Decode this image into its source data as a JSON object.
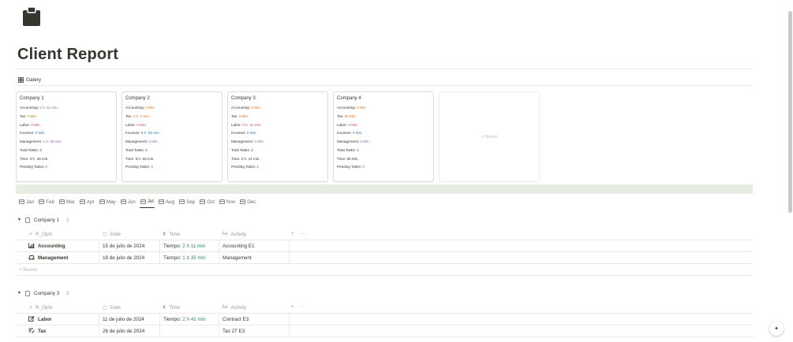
{
  "page": {
    "title": "Client Report",
    "icon": "clipboard-icon"
  },
  "view": {
    "tab_label": "Galery",
    "icon": "grid-icon"
  },
  "cards": [
    {
      "title": "Company 1",
      "rows": [
        {
          "label": "Accounting: ",
          "value": "2 h. 11 min.",
          "color": "purple"
        },
        {
          "label": "Tax: ",
          "value": "0 Min.",
          "color": "orange"
        },
        {
          "label": "Labor: ",
          "value": "0 Min.",
          "color": "red"
        },
        {
          "label": "Incomes: ",
          "value": "0 Min.",
          "color": "blue"
        },
        {
          "label": "Management: ",
          "value": "1 h. 35 min.",
          "color": "purple"
        },
        {
          "label": "Total Tasks: ",
          "value": "2",
          "color": "black"
        },
        {
          "label": "Time: ",
          "value": "3 h. 46 min.",
          "color": "black"
        },
        {
          "label": "Pending Tasks: ",
          "value": "0",
          "color": "red"
        }
      ]
    },
    {
      "title": "Company 2",
      "rows": [
        {
          "label": "Accounting: ",
          "value": "0 Min.",
          "color": "orange"
        },
        {
          "label": "Tax: ",
          "value": "2 h. 4 min.",
          "color": "orange"
        },
        {
          "label": "Labor: ",
          "value": "0 Min.",
          "color": "red"
        },
        {
          "label": "Incomes: ",
          "value": "6 h. 55 min.",
          "color": "blue"
        },
        {
          "label": "Management: ",
          "value": "0 Min.",
          "color": "purple"
        },
        {
          "label": "Total Tasks: ",
          "value": "2",
          "color": "black"
        },
        {
          "label": "Time: ",
          "value": "8 h. 59 min.",
          "color": "black"
        },
        {
          "label": "Pending Tasks: ",
          "value": "0",
          "color": "red"
        }
      ]
    },
    {
      "title": "Company 3",
      "rows": [
        {
          "label": "Accounting: ",
          "value": "0 Min.",
          "color": "orange"
        },
        {
          "label": "Tax: ",
          "value": "0 Min.",
          "color": "orange"
        },
        {
          "label": "Labor: ",
          "value": "2 h. 41 min.",
          "color": "red"
        },
        {
          "label": "Incomes: ",
          "value": "0 Min.",
          "color": "blue"
        },
        {
          "label": "Management: ",
          "value": "0 Min.",
          "color": "purple"
        },
        {
          "label": "Total Tasks: ",
          "value": "2",
          "color": "black"
        },
        {
          "label": "Time: ",
          "value": "2 h. 41 min.",
          "color": "black"
        },
        {
          "label": "Pending Tasks: ",
          "value": "1",
          "color": "red"
        }
      ]
    },
    {
      "title": "Company 4",
      "rows": [
        {
          "label": "Accounting: ",
          "value": "0 Min.",
          "color": "orange"
        },
        {
          "label": "Tax: ",
          "value": "55 Min.",
          "color": "orange"
        },
        {
          "label": "Labor: ",
          "value": "0 Min.",
          "color": "red"
        },
        {
          "label": "Incomes: ",
          "value": "0 Min.",
          "color": "blue"
        },
        {
          "label": "Management: ",
          "value": "0 Min.",
          "color": "purple"
        },
        {
          "label": "Total Tasks: ",
          "value": "1",
          "color": "black"
        },
        {
          "label": "Time: ",
          "value": "55 Min.",
          "color": "black"
        },
        {
          "label": "Pending Tasks: ",
          "value": "0",
          "color": "red"
        }
      ]
    }
  ],
  "new_card_label": "+ Nuevo",
  "months": [
    "Jan",
    "Feb",
    "Mar",
    "Apr",
    "May",
    "Jun",
    "Jul",
    "Aug",
    "Sep",
    "Oct",
    "Nov",
    "Dec"
  ],
  "active_month": "Jul",
  "columns": {
    "ropts": "R_Opts",
    "date": "Date",
    "time": "Time",
    "activity": "Activity"
  },
  "groups": [
    {
      "name": "Company 1",
      "count": "2",
      "rows": [
        {
          "ropts": "Accounting",
          "icon": "chart-icon",
          "date": "15 de julio de 2024",
          "time_prefix": "Tiempo: ",
          "time": "2 h 11 min",
          "activity": "Accounting E1"
        },
        {
          "ropts": "Management",
          "icon": "car-icon",
          "date": "18 de julio de 2024",
          "time_prefix": "Tiempo: ",
          "time": "1 h 35 min",
          "activity": "Management"
        }
      ],
      "new_label": "+ Nuevo"
    },
    {
      "name": "Company 3",
      "count": "2",
      "rows": [
        {
          "ropts": "Labor",
          "icon": "edit-icon",
          "date": "11 de julio de 2024",
          "time_prefix": "Tiempo: ",
          "time": "2 h 41 min",
          "activity": "Contract E3"
        },
        {
          "ropts": "Tax",
          "icon": "list-edit-icon",
          "date": "26 de julio de 2024",
          "time_prefix": "",
          "time": "",
          "activity": "Tax 2T E3"
        }
      ]
    }
  ],
  "colors": {
    "orange": "#d9730d",
    "blue": "#2e77b8",
    "red": "#d44c47",
    "purple": "#9065b0",
    "banner": "#e7ede3"
  }
}
